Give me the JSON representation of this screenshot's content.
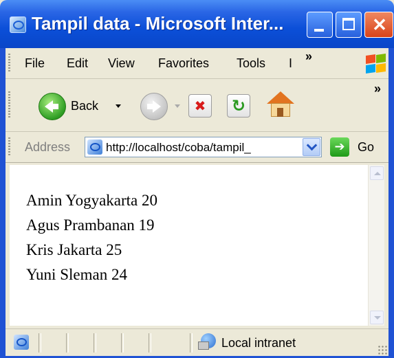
{
  "window": {
    "title": "Tampil data - Microsoft Inter...",
    "controls": {
      "close_glyph": "✕"
    }
  },
  "menubar": {
    "items": [
      "File",
      "Edit",
      "View",
      "Favorites",
      "Tools",
      "I"
    ],
    "overflow": "»"
  },
  "toolbar": {
    "back_label": "Back",
    "overflow": "»"
  },
  "addressbar": {
    "label": "Address",
    "url": "http://localhost/coba/tampil_",
    "go_label": "Go"
  },
  "content": {
    "lines": [
      "Amin Yogyakarta 20",
      "Agus Prambanan 19",
      "Kris Jakarta 25",
      "Yuni Sleman 24"
    ]
  },
  "statusbar": {
    "zone": "Local intranet"
  },
  "icons": {
    "title": "ie-page-icon",
    "back": "back-arrow-icon",
    "forward": "forward-arrow-icon",
    "stop": "stop-icon",
    "refresh": "refresh-icon",
    "home": "home-icon",
    "go": "go-arrow-icon",
    "zone": "local-intranet-icon",
    "logo": "windows-logo-icon"
  },
  "colors": {
    "titlebar": "#0b4fd8",
    "chrome": "#ece9d8",
    "close_button": "#d8431a"
  }
}
